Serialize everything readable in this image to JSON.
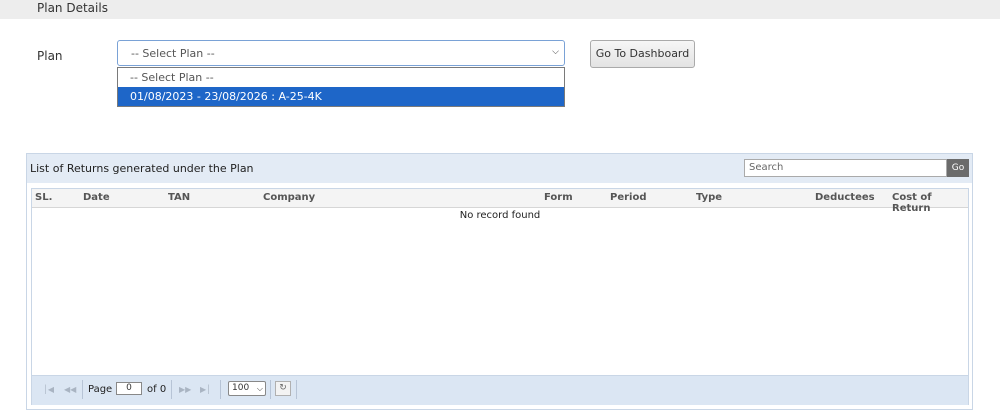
{
  "header": {
    "title": "Plan Details"
  },
  "plan_form": {
    "label": "Plan",
    "select_value": "-- Select Plan --",
    "options": [
      "-- Select Plan --",
      "01/08/2023 - 23/08/2026 : A-25-4K"
    ],
    "dashboard_button": "Go To Dashboard"
  },
  "returns_panel": {
    "title": "List of Returns generated under the Plan",
    "search_placeholder": "Search",
    "go_label": "Go",
    "columns": [
      "SL.",
      "Date",
      "TAN",
      "Company",
      "Form",
      "Period",
      "Type",
      "Deductees",
      "Cost of Return"
    ],
    "empty_text": "No record found"
  },
  "pager": {
    "page_label": "Page",
    "page_value": "0",
    "of_label": "of 0",
    "page_size": "100",
    "icons": [
      "first-page-icon",
      "prev-page-icon",
      "next-page-icon",
      "last-page-icon",
      "refresh-icon"
    ]
  }
}
